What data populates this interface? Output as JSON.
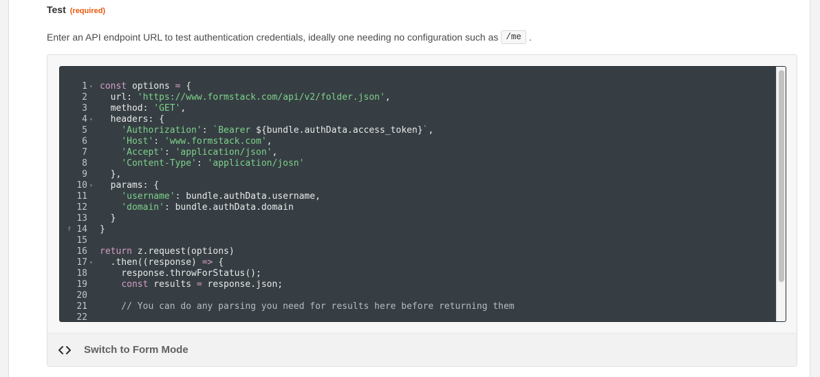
{
  "field": {
    "title": "Test",
    "required_label": "(required)",
    "help_text": "Enter an API endpoint URL to test authentication credentials, ideally one needing no configuration such as",
    "help_code": "/me",
    "help_suffix": "."
  },
  "editor": {
    "lines": [
      {
        "num": "1",
        "fold": true,
        "segments": [
          [
            "kw",
            "const"
          ],
          [
            "plain",
            " options "
          ],
          [
            "op",
            "="
          ],
          [
            "plain",
            " {"
          ]
        ]
      },
      {
        "num": "2",
        "segments": [
          [
            "plain",
            "  url: "
          ],
          [
            "str",
            "'https://www.formstack.com/api/v2/folder.json'"
          ],
          [
            "plain",
            ","
          ]
        ]
      },
      {
        "num": "3",
        "segments": [
          [
            "plain",
            "  method: "
          ],
          [
            "str",
            "'GET'"
          ],
          [
            "plain",
            ","
          ]
        ]
      },
      {
        "num": "4",
        "fold": true,
        "segments": [
          [
            "plain",
            "  headers: {"
          ]
        ]
      },
      {
        "num": "5",
        "segments": [
          [
            "plain",
            "    "
          ],
          [
            "str",
            "'Authorization'"
          ],
          [
            "plain",
            ": "
          ],
          [
            "str",
            "`Bearer "
          ],
          [
            "plain",
            "${bundle.authData.access_token}"
          ],
          [
            "str",
            "`"
          ],
          [
            "plain",
            ","
          ]
        ]
      },
      {
        "num": "6",
        "segments": [
          [
            "plain",
            "    "
          ],
          [
            "str",
            "'Host'"
          ],
          [
            "plain",
            ": "
          ],
          [
            "str",
            "'www.formstack.com'"
          ],
          [
            "plain",
            ","
          ]
        ]
      },
      {
        "num": "7",
        "segments": [
          [
            "plain",
            "    "
          ],
          [
            "str",
            "'Accept'"
          ],
          [
            "plain",
            ": "
          ],
          [
            "str",
            "'application/json'"
          ],
          [
            "plain",
            ","
          ]
        ]
      },
      {
        "num": "8",
        "segments": [
          [
            "plain",
            "    "
          ],
          [
            "str",
            "'Content-Type'"
          ],
          [
            "plain",
            ": "
          ],
          [
            "str",
            "'application/josn'"
          ]
        ]
      },
      {
        "num": "9",
        "segments": [
          [
            "plain",
            "  },"
          ]
        ]
      },
      {
        "num": "10",
        "fold": true,
        "segments": [
          [
            "plain",
            "  params: {"
          ]
        ]
      },
      {
        "num": "11",
        "segments": [
          [
            "plain",
            "    "
          ],
          [
            "str",
            "'username'"
          ],
          [
            "plain",
            ": bundle.authData.username,"
          ]
        ]
      },
      {
        "num": "12",
        "segments": [
          [
            "plain",
            "    "
          ],
          [
            "str",
            "'domain'"
          ],
          [
            "plain",
            ": bundle.authData.domain"
          ]
        ]
      },
      {
        "num": "13",
        "segments": [
          [
            "plain",
            "  }"
          ]
        ]
      },
      {
        "num": "14",
        "marker": "f",
        "segments": [
          [
            "plain",
            "}"
          ]
        ]
      },
      {
        "num": "15",
        "segments": []
      },
      {
        "num": "16",
        "segments": [
          [
            "kw",
            "return"
          ],
          [
            "plain",
            " z.request(options)"
          ]
        ]
      },
      {
        "num": "17",
        "fold": true,
        "segments": [
          [
            "plain",
            "  .then((response) "
          ],
          [
            "op",
            "=>"
          ],
          [
            "plain",
            " {"
          ]
        ]
      },
      {
        "num": "18",
        "segments": [
          [
            "plain",
            "    response.throwForStatus();"
          ]
        ]
      },
      {
        "num": "19",
        "segments": [
          [
            "plain",
            "    "
          ],
          [
            "kw",
            "const"
          ],
          [
            "plain",
            " results "
          ],
          [
            "op",
            "="
          ],
          [
            "plain",
            " response.json;"
          ]
        ]
      },
      {
        "num": "20",
        "segments": []
      },
      {
        "num": "21",
        "segments": [
          [
            "cm",
            "    // You can do any parsing you need for results here before returning them"
          ]
        ]
      },
      {
        "num": "22",
        "segments": []
      }
    ]
  },
  "footer": {
    "icon": "code-brackets-icon",
    "switch_label": "Switch to Form Mode"
  },
  "colors": {
    "required": "#e8580c",
    "editor_bg": "#363e43",
    "keyword": "#d69ec8",
    "string": "#7fd18b"
  }
}
